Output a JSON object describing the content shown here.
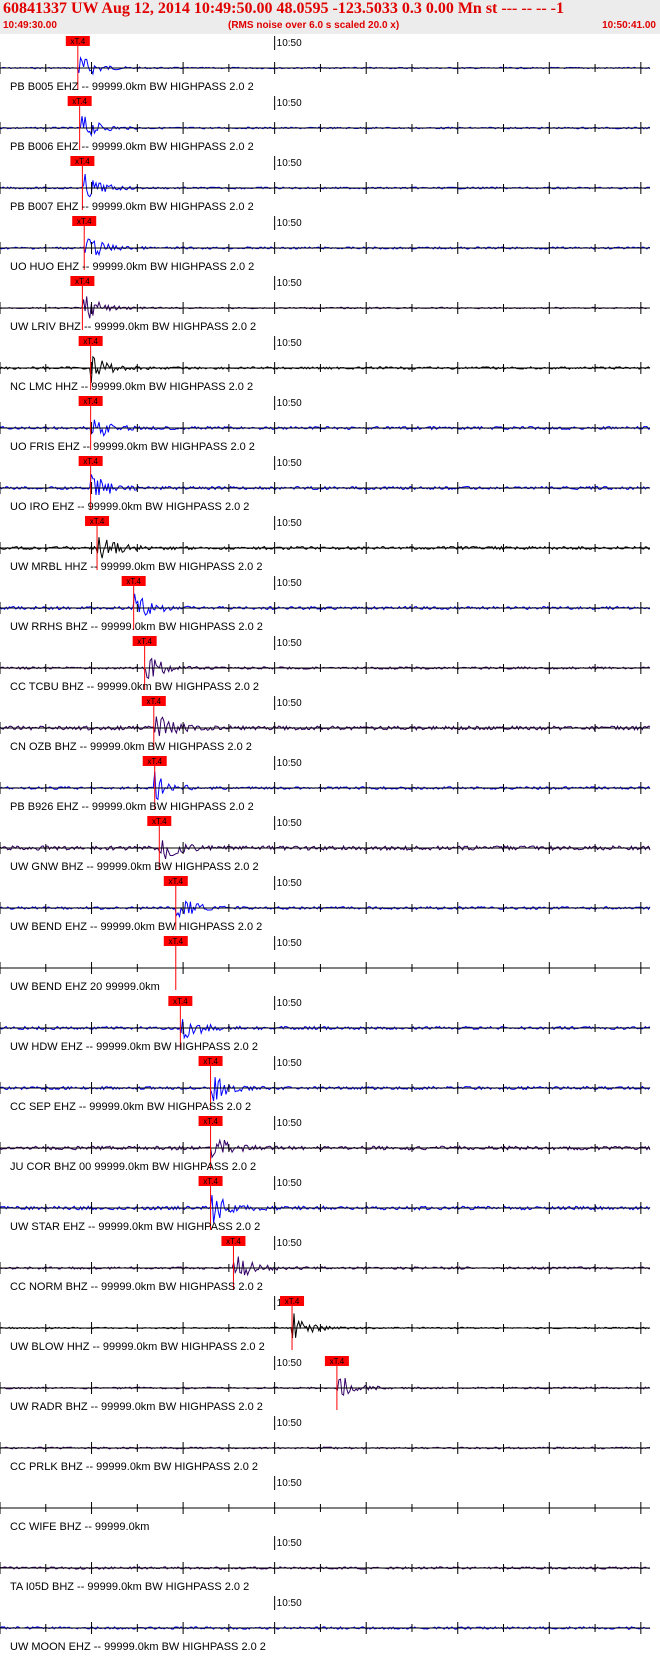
{
  "header": {
    "title": "60841337 UW Aug 12, 2014 10:49:50.00   48.0595 -123.5033  0.3 0.00 Mn st --- -- --  -1",
    "start_time": "10:49:30.00",
    "note": "(RMS noise over 6.0 s scaled 20.0 x)",
    "end_time": "10:50:41.00"
  },
  "chart_data": {
    "type": "line",
    "title": "60841337 UW Aug 12, 2014 10:49:50.00   48.0595 -123.5033  0.3 0.00 Mn st --- -- --  -1",
    "x_unit": "time",
    "x_range": [
      "10:49:30.00",
      "10:50:41.00"
    ],
    "minute_tick_label": "10:50",
    "pick_label": "xT.4",
    "colors": {
      "pick": "#ff0000",
      "header_text": "#e00000",
      "axis": "#000000"
    },
    "traces": [
      {
        "label": "PB B005 EHZ -- 99999.0km BW  HIGHPASS  2.0  2",
        "color": "#0000ff",
        "pick_s": 8.5,
        "noise": 0.12,
        "spike": 0
      },
      {
        "label": "PB B006 EHZ -- 99999.0km BW  HIGHPASS  2.0  2",
        "color": "#0000ff",
        "pick_s": 8.7,
        "noise": 0.14,
        "spike": 0
      },
      {
        "label": "PB B007 EHZ -- 99999.0km BW  HIGHPASS  2.0  2",
        "color": "#0000ff",
        "pick_s": 9.0,
        "noise": 0.16,
        "spike": 0
      },
      {
        "label": "UO HUO EHZ -- 99999.0km BW  HIGHPASS  2.0  2",
        "color": "#0000ff",
        "pick_s": 9.2,
        "noise": 0.18,
        "spike": 0
      },
      {
        "label": "UW LRIV BHZ -- 99999.0km BW  HIGHPASS  2.0  2",
        "color": "#330066",
        "pick_s": 9.0,
        "noise": 0.12,
        "spike": 0
      },
      {
        "label": "NC LMC HHZ -- 99999.0km BW  HIGHPASS  2.0  2",
        "color": "#000000",
        "pick_s": 9.9,
        "noise": 0.2,
        "spike": 0
      },
      {
        "label": "UO FRIS EHZ -- 99999.0km BW  HIGHPASS  2.0  2",
        "color": "#0000ff",
        "pick_s": 9.9,
        "noise": 0.25,
        "spike": 0
      },
      {
        "label": "UO IRO EHZ -- 99999.0km BW  HIGHPASS  2.0  2",
        "color": "#0000ff",
        "pick_s": 9.9,
        "noise": 0.25,
        "spike": 0
      },
      {
        "label": "UW MRBL HHZ -- 99999.0km BW  HIGHPASS  2.0  2",
        "color": "#000000",
        "pick_s": 10.6,
        "noise": 0.25,
        "spike": 0
      },
      {
        "label": "UW RRHS BHZ -- 99999.0km BW  HIGHPASS  2.0  2",
        "color": "#0000ff",
        "pick_s": 14.6,
        "noise": 0.25,
        "spike": 0
      },
      {
        "label": "CC TCBU BHZ -- 99999.0km BW  HIGHPASS  2.0  2",
        "color": "#330066",
        "pick_s": 15.8,
        "noise": 0.2,
        "spike": 0
      },
      {
        "label": "CN OZB BHZ -- 99999.0km BW  HIGHPASS  2.0  2",
        "color": "#330066",
        "pick_s": 16.8,
        "noise": 0.32,
        "spike": 0
      },
      {
        "label": "PB B926 EHZ -- 99999.0km BW  HIGHPASS  2.0  2",
        "color": "#0000ff",
        "pick_s": 16.9,
        "noise": 0.22,
        "spike": 0
      },
      {
        "label": "UW GNW BHZ -- 99999.0km BW  HIGHPASS  2.0  2",
        "color": "#330066",
        "pick_s": 17.4,
        "noise": 0.35,
        "spike": 0
      },
      {
        "label": "UW BEND EHZ -- 99999.0km BW  HIGHPASS  2.0  2",
        "color": "#0000ff",
        "pick_s": 19.2,
        "noise": 0.22,
        "spike": 0
      },
      {
        "label": "UW BEND EHZ 20 99999.0km",
        "color": "#0000ff",
        "pick_s": 19.2,
        "noise": 0,
        "spike": 0
      },
      {
        "label": "UW HDW EHZ -- 99999.0km BW  HIGHPASS  2.0  2",
        "color": "#0000ff",
        "pick_s": 19.7,
        "noise": 0.25,
        "spike": 0
      },
      {
        "label": "CC SEP EHZ -- 99999.0km BW  HIGHPASS  2.0  2",
        "color": "#0000ff",
        "pick_s": 23.0,
        "noise": 0.25,
        "spike": 0
      },
      {
        "label": "JU COR BHZ 00 99999.0km BW  HIGHPASS  2.0  2",
        "color": "#330066",
        "pick_s": 23.0,
        "noise": 0.3,
        "spike": 0
      },
      {
        "label": "UW STAR EHZ -- 99999.0km BW  HIGHPASS  2.0  2",
        "color": "#0000ff",
        "pick_s": 23.0,
        "noise": 0.3,
        "spike": 0
      },
      {
        "label": "CC NORM BHZ -- 99999.0km BW  HIGHPASS  2.0  2",
        "color": "#330066",
        "pick_s": 25.5,
        "noise": 0.2,
        "spike": 0
      },
      {
        "label": "UW BLOW HHZ -- 99999.0km BW  HIGHPASS  2.0  2",
        "color": "#000000",
        "pick_s": 31.9,
        "noise": 0.12,
        "spike": 0
      },
      {
        "label": "UW RADR BHZ -- 99999.0km BW  HIGHPASS  2.0  2",
        "color": "#330066",
        "pick_s": 36.8,
        "noise": 0.15,
        "spike": 0
      },
      {
        "label": "CC PRLK BHZ -- 99999.0km BW  HIGHPASS  2.0  2",
        "color": "#330066",
        "pick_s": null,
        "noise": 0.15,
        "spike": 0
      },
      {
        "label": "CC WIFE BHZ -- 99999.0km",
        "color": "#330066",
        "pick_s": null,
        "noise": 0,
        "spike": 0
      },
      {
        "label": "TA I05D BHZ -- 99999.0km BW  HIGHPASS  2.0  2",
        "color": "#330066",
        "pick_s": null,
        "noise": 0.2,
        "spike": 0
      },
      {
        "label": "UW MOON EHZ -- 99999.0km BW  HIGHPASS  2.0  2",
        "color": "#0000ff",
        "pick_s": null,
        "noise": 0.2,
        "spike": 0
      }
    ]
  }
}
